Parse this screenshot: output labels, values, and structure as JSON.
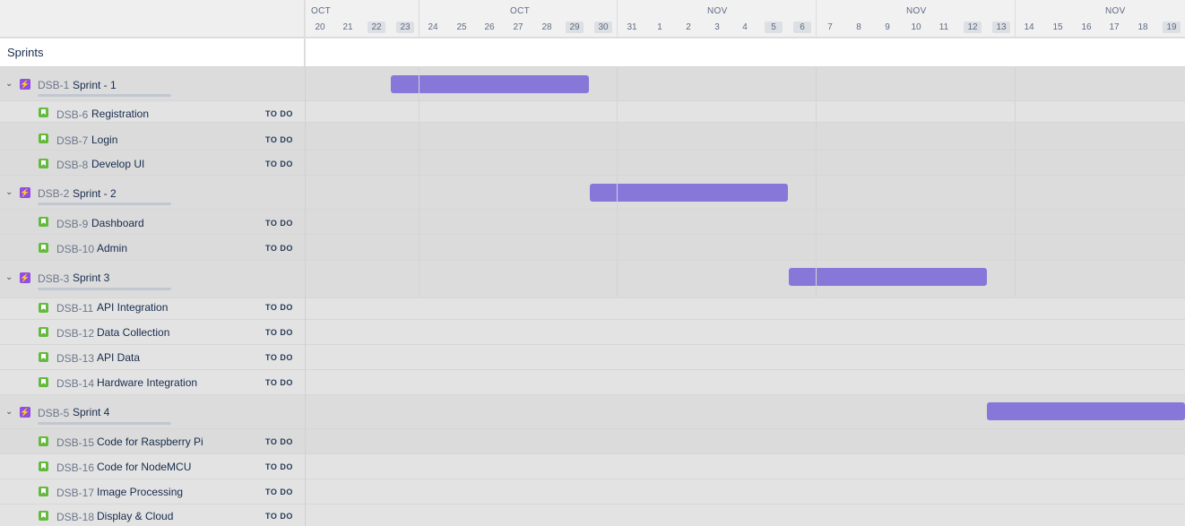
{
  "header": {
    "sprints_label": "Sprints",
    "months": [
      "OCT",
      "OCT",
      "NOV",
      "NOV",
      "NOV"
    ],
    "days": [
      "20",
      "21",
      "22",
      "23",
      "24",
      "25",
      "26",
      "27",
      "28",
      "29",
      "30",
      "31",
      "1",
      "2",
      "3",
      "4",
      "5",
      "6",
      "7",
      "8",
      "9",
      "10",
      "11",
      "12",
      "13",
      "14",
      "15",
      "16",
      "17",
      "18",
      "19"
    ]
  },
  "sprints": [
    {
      "key": "DSB-1",
      "name": "Sprint - 1",
      "issues": [
        {
          "key": "DSB-6",
          "title": "Registration",
          "status": "TO DO"
        },
        {
          "key": "DSB-7",
          "title": "Login",
          "status": "TO DO"
        },
        {
          "key": "DSB-8",
          "title": "Develop UI",
          "status": "TO DO"
        }
      ]
    },
    {
      "key": "DSB-2",
      "name": "Sprint - 2",
      "issues": [
        {
          "key": "DSB-9",
          "title": "Dashboard",
          "status": "TO DO"
        },
        {
          "key": "DSB-10",
          "title": "Admin",
          "status": "TO DO"
        }
      ]
    },
    {
      "key": "DSB-3",
      "name": "Sprint 3",
      "issues": [
        {
          "key": "DSB-11",
          "title": "API Integration",
          "status": "TO DO"
        },
        {
          "key": "DSB-12",
          "title": "Data Collection",
          "status": "TO DO"
        },
        {
          "key": "DSB-13",
          "title": "API Data",
          "status": "TO DO"
        },
        {
          "key": "DSB-14",
          "title": "Hardware  Integration",
          "status": "TO DO"
        }
      ]
    },
    {
      "key": "DSB-5",
      "name": "Sprint 4",
      "issues": [
        {
          "key": "DSB-15",
          "title": "Code for Raspberry Pi",
          "status": "TO DO"
        },
        {
          "key": "DSB-16",
          "title": "Code for NodeMCU",
          "status": "TO DO"
        },
        {
          "key": "DSB-17",
          "title": "Image  Processing",
          "status": "TO DO"
        },
        {
          "key": "DSB-18",
          "title": "Display & Cloud",
          "status": "TO DO"
        }
      ]
    }
  ],
  "colors": {
    "bar": "#8777d9",
    "epic_icon": "#904ee2",
    "story_icon": "#63ba3c"
  }
}
